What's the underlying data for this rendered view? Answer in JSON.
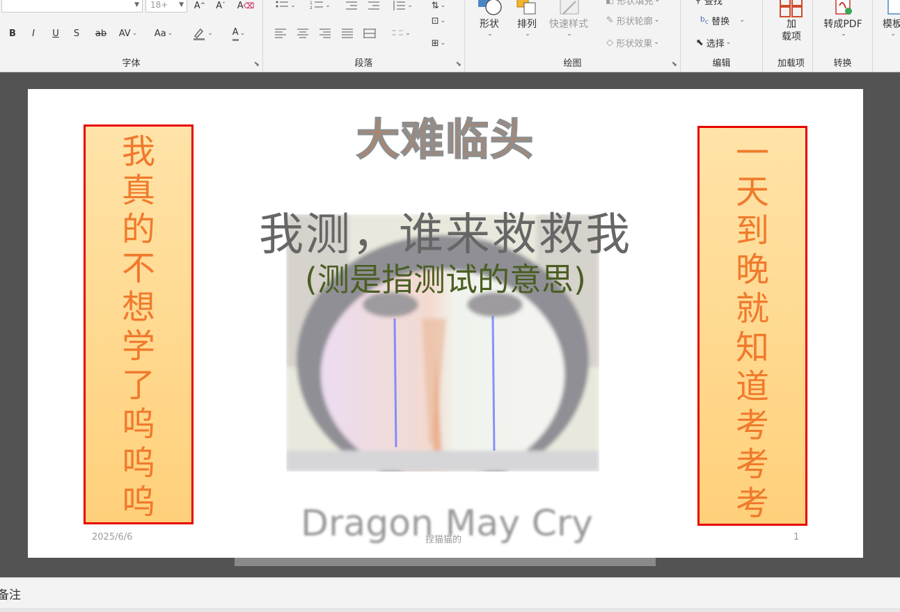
{
  "ribbon": {
    "font_group": {
      "label": "字体",
      "font_size": "18+",
      "buttons": [
        "B",
        "I",
        "U",
        "S",
        "ab",
        "AV",
        "Aa",
        "A"
      ]
    },
    "paragraph_group": {
      "label": "段落"
    },
    "drawing_group": {
      "label": "绘图",
      "shapes_label": "形状",
      "arrange_label": "排列",
      "quick_styles_label": "快速样式",
      "shape_fill_label": "形状填充",
      "shape_outline_label": "形状轮廓",
      "shape_effects_label": "形状效果"
    },
    "editing_group": {
      "label": "编辑",
      "find_label": "查找",
      "replace_label": "替换",
      "select_label": "选择"
    },
    "addins_group": {
      "label": "加载项",
      "button_label": "加\n载项"
    },
    "convert_group": {
      "label": "转换",
      "button_label": "转成PDF"
    },
    "more_label": "模板"
  },
  "slide": {
    "title": "大难临头",
    "subtitle": "我测，谁来救救我",
    "note": "(测是指测试的意思)",
    "brand_text": "Dragon May Cry",
    "left_scroll": "我真的不想学了呜呜呜",
    "right_scroll": "一天到晚就知道考考考",
    "footer_date": "2025/6/6",
    "footer_author": "捏猫猫的",
    "footer_page": "1"
  },
  "notes_label": "备注",
  "colors": {
    "title": "#e9742d",
    "scroll_text": "#f07a2c",
    "scroll_border": "#e60000",
    "scroll_fill": "#ffd07a",
    "note_text": "#4a5e22"
  }
}
